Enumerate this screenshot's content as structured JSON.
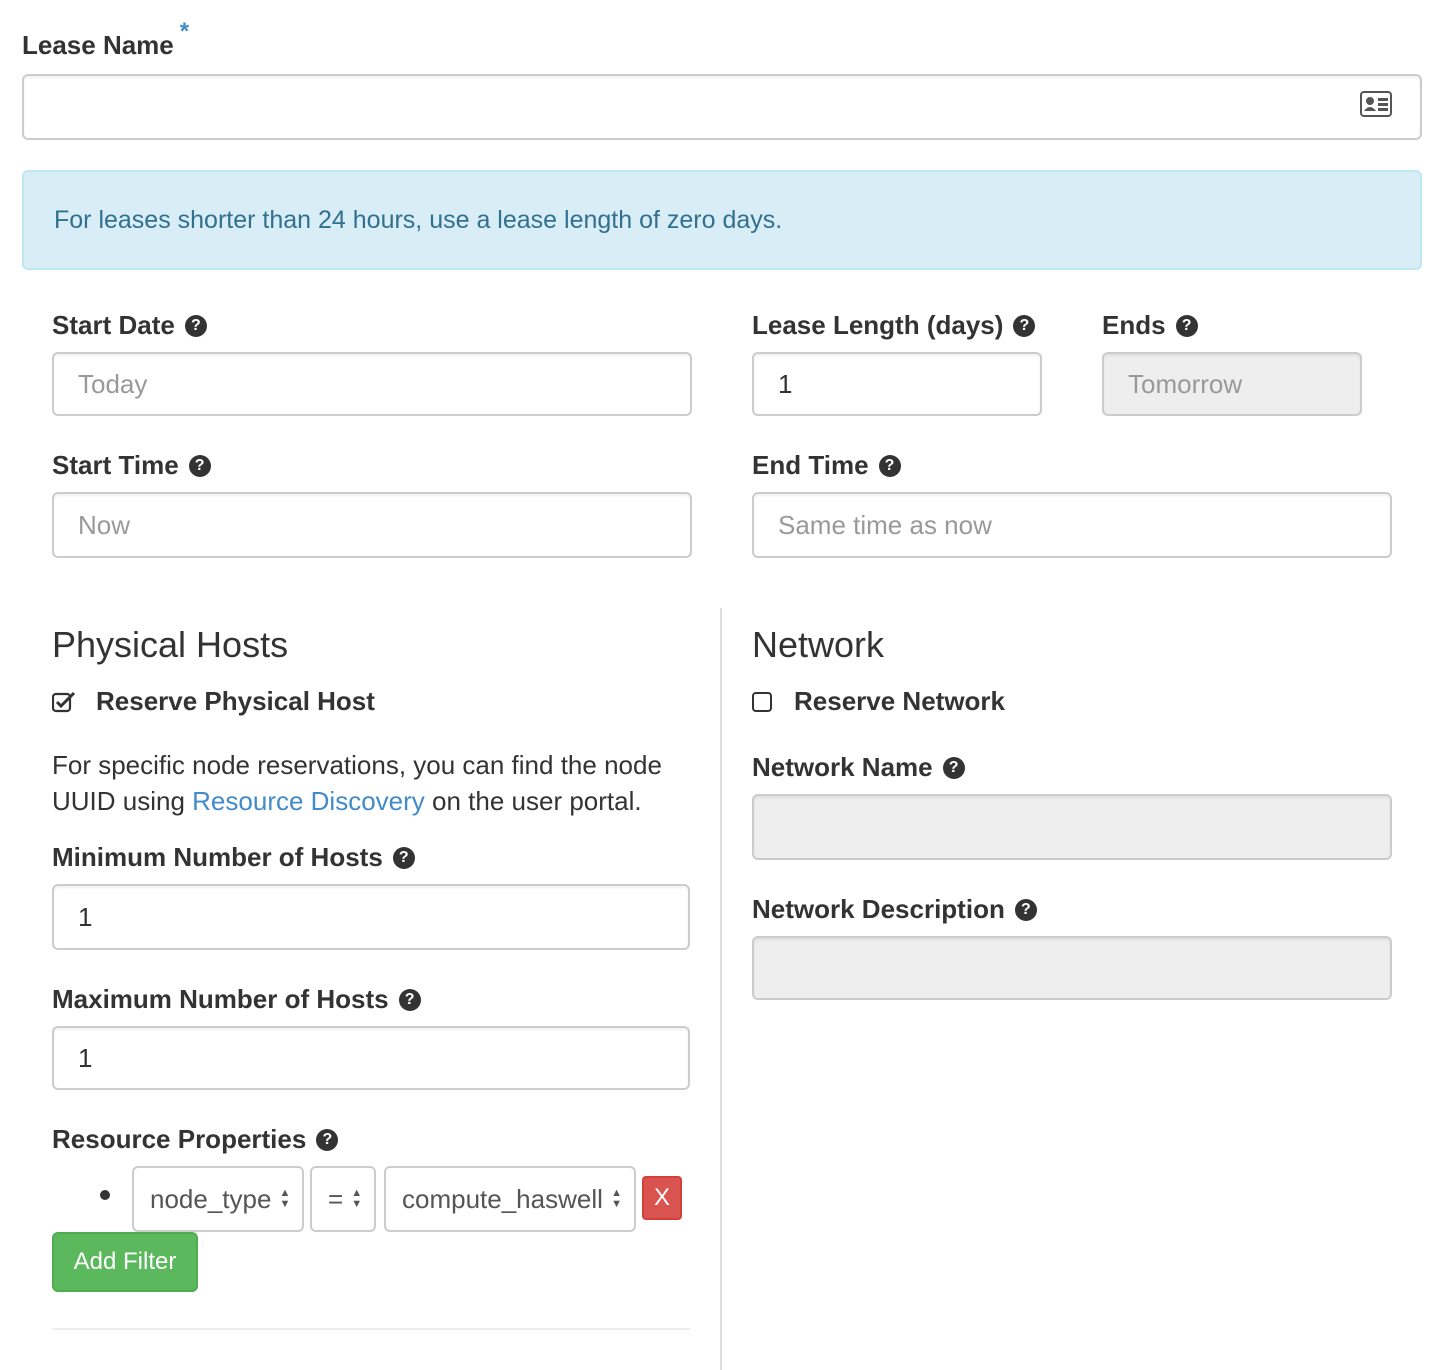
{
  "lease_name": {
    "label": "Lease Name",
    "required_marker": "*",
    "value": ""
  },
  "alert": {
    "text": "For leases shorter than 24 hours, use a lease length of zero days."
  },
  "start_date": {
    "label": "Start Date",
    "placeholder": "Today"
  },
  "lease_length": {
    "label": "Lease Length (days)",
    "value": "1"
  },
  "ends": {
    "label": "Ends",
    "placeholder": "Tomorrow"
  },
  "start_time": {
    "label": "Start Time",
    "placeholder": "Now"
  },
  "end_time": {
    "label": "End Time",
    "placeholder": "Same time as now"
  },
  "physical_hosts": {
    "title": "Physical Hosts",
    "reserve_label": "Reserve Physical Host",
    "reserve_checked": true,
    "info_part1": "For specific node reservations, you can find the node",
    "info_part2": "UUID using ",
    "info_link": "Resource Discovery",
    "info_part3": " on the user portal.",
    "min_hosts_label": "Minimum Number of Hosts",
    "min_hosts_value": "1",
    "max_hosts_label": "Maximum Number of Hosts",
    "max_hosts_value": "1",
    "resource_properties_label": "Resource Properties",
    "filters": [
      {
        "property": "node_type",
        "operator": "=",
        "value": "compute_haswell",
        "remove_label": "X"
      }
    ],
    "add_filter_label": "Add Filter"
  },
  "network": {
    "title": "Network",
    "reserve_label": "Reserve Network",
    "reserve_checked": false,
    "name_label": "Network Name",
    "name_value": "",
    "description_label": "Network Description",
    "description_value": ""
  },
  "icons": {
    "help": "question-circle-icon",
    "id_card": "id-card-icon"
  },
  "colors": {
    "link": "#428bca",
    "alert_bg": "#d9edf7",
    "danger": "#d9534f",
    "success": "#5cb85c"
  }
}
